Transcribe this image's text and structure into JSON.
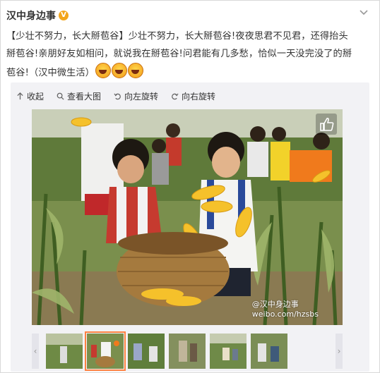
{
  "post": {
    "author": "汉中身边事",
    "verified_badge": "V",
    "text_line1": "【少壮不努力，长大掰苞谷】少壮不努力，长大掰苞谷!夜夜思君不见君，还得抬头",
    "text_line2": "掰苞谷!亲朋好友如相问，就说我在掰苞谷!问君能有几多愁，恰似一天没完没了的掰",
    "text_line3": "苞谷!（汉中微生活）"
  },
  "toolbar": {
    "collapse": "收起",
    "view_large": "查看大图",
    "rotate_left": "向左旋转",
    "rotate_right": "向右旋转"
  },
  "photo": {
    "watermark_name": "@汉中身边事",
    "watermark_url": "weibo.com/hzsbs"
  },
  "thumbnails": {
    "count": 6,
    "active_index": 1
  },
  "colors": {
    "accent": "#ff8140",
    "verified": "#f3a51c"
  }
}
